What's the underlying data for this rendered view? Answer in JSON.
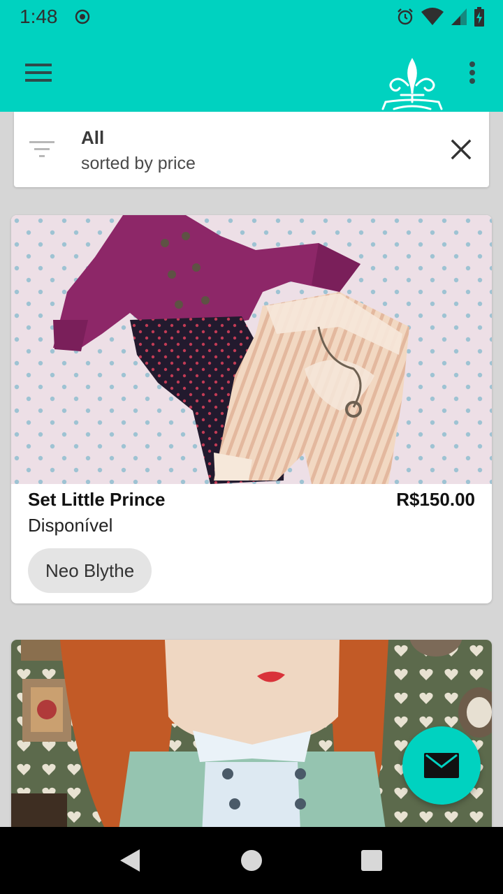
{
  "status_bar": {
    "time": "1:48",
    "icons": [
      "record-icon",
      "alarm-icon",
      "wifi-icon",
      "signal-icon",
      "battery-icon"
    ]
  },
  "app_bar": {
    "icons": [
      "menu-icon",
      "fleur-de-lis-logo",
      "more-vert-icon"
    ],
    "accent_color": "#00d2c0"
  },
  "filter": {
    "title": "All",
    "subtitle": "sorted by price",
    "icons": [
      "filter-icon",
      "close-icon"
    ]
  },
  "products": [
    {
      "name": "Set Little Prince",
      "price": "R$150.00",
      "availability": "Disponível",
      "tag": "Neo Blythe"
    }
  ],
  "fab": {
    "icon": "mail-icon"
  },
  "nav_bar": {
    "icons": [
      "back-icon",
      "home-icon",
      "recents-icon"
    ]
  }
}
